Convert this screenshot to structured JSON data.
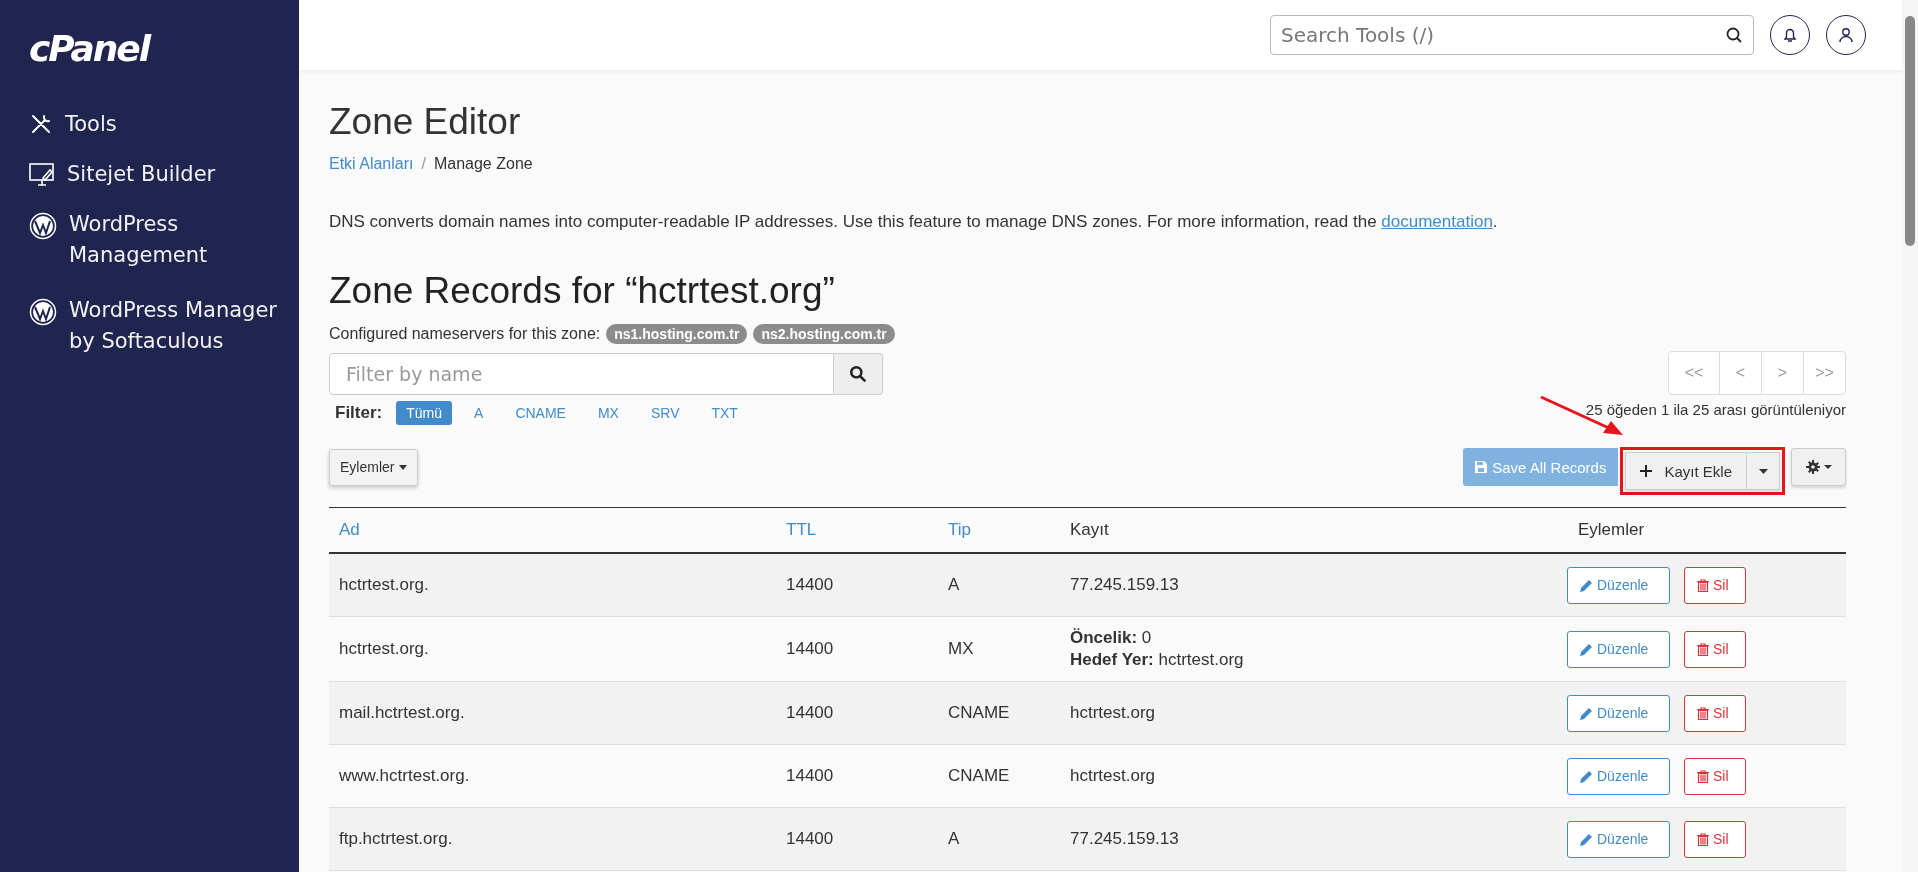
{
  "sidebar": {
    "logo": "cPanel",
    "items": [
      {
        "label": "Tools",
        "kind": "tools"
      },
      {
        "label": "Sitejet Builder",
        "kind": "monitor"
      },
      {
        "label": "WordPress Management",
        "kind": "wordpress"
      },
      {
        "label": "WordPress Manager by Softaculous",
        "kind": "wordpress"
      }
    ]
  },
  "header": {
    "search": {
      "placeholder": "Search Tools (/)"
    }
  },
  "page": {
    "title": "Zone Editor",
    "separator": "/",
    "breadcrumb": [
      {
        "label": "Etki Alanları",
        "link": true
      },
      {
        "label": "Manage Zone",
        "link": false
      }
    ],
    "description": {
      "text": "DNS converts domain names into computer-readable IP addresses. Use this feature to manage DNS zones. For more information, read the ",
      "link": "documentation",
      "after": "."
    }
  },
  "zone": {
    "heading": "Zone Records for “hctrtest.org”",
    "nameservers_label": "Configured nameservers for this zone:",
    "nameservers": [
      "ns1.hosting.com.tr",
      "ns2.hosting.com.tr"
    ],
    "filter": {
      "placeholder": "Filter by name",
      "label": "Filter:",
      "types": [
        {
          "label": "Tümü",
          "selected": true
        },
        {
          "label": "A",
          "selected": false
        },
        {
          "label": "CNAME",
          "selected": false
        },
        {
          "label": "MX",
          "selected": false
        },
        {
          "label": "SRV",
          "selected": false
        },
        {
          "label": "TXT",
          "selected": false
        }
      ]
    },
    "pagination": [
      "<<",
      "<",
      ">",
      ">>"
    ],
    "count": "25 öğeden 1 ila 25 arası görüntüleniyor",
    "toolbar": {
      "actions": "Eylemler",
      "save": {
        "label": "Save All Records",
        "disabled": true
      },
      "add": "Kayıt Ekle"
    },
    "table": {
      "columns": [
        {
          "label": "Ad",
          "sortable": true
        },
        {
          "label": "TTL",
          "sortable": true
        },
        {
          "label": "Tip",
          "sortable": true
        },
        {
          "label": "Kayıt",
          "sortable": false
        },
        {
          "label": "Eylemler",
          "sortable": false
        }
      ],
      "rows": [
        {
          "name": "hctrtest.org.",
          "ttl": "14400",
          "type": "A",
          "record": [
            "77.245.159.13"
          ],
          "edit": "Düzenle",
          "delete": "Sil"
        },
        {
          "name": "hctrtest.org.",
          "ttl": "14400",
          "type": "MX",
          "record": [
            "**Öncelik:** 0",
            "**Hedef Yer:** hctrtest.org"
          ],
          "edit": "Düzenle",
          "delete": "Sil"
        },
        {
          "name": "mail.hctrtest.org.",
          "ttl": "14400",
          "type": "CNAME",
          "record": [
            "hctrtest.org"
          ],
          "edit": "Düzenle",
          "delete": "Sil"
        },
        {
          "name": "www.hctrtest.org.",
          "ttl": "14400",
          "type": "CNAME",
          "record": [
            "hctrtest.org"
          ],
          "edit": "Düzenle",
          "delete": "Sil"
        },
        {
          "name": "ftp.hctrtest.org.",
          "ttl": "14400",
          "type": "A",
          "record": [
            "77.245.159.13"
          ],
          "edit": "Düzenle",
          "delete": "Sil"
        }
      ]
    }
  }
}
